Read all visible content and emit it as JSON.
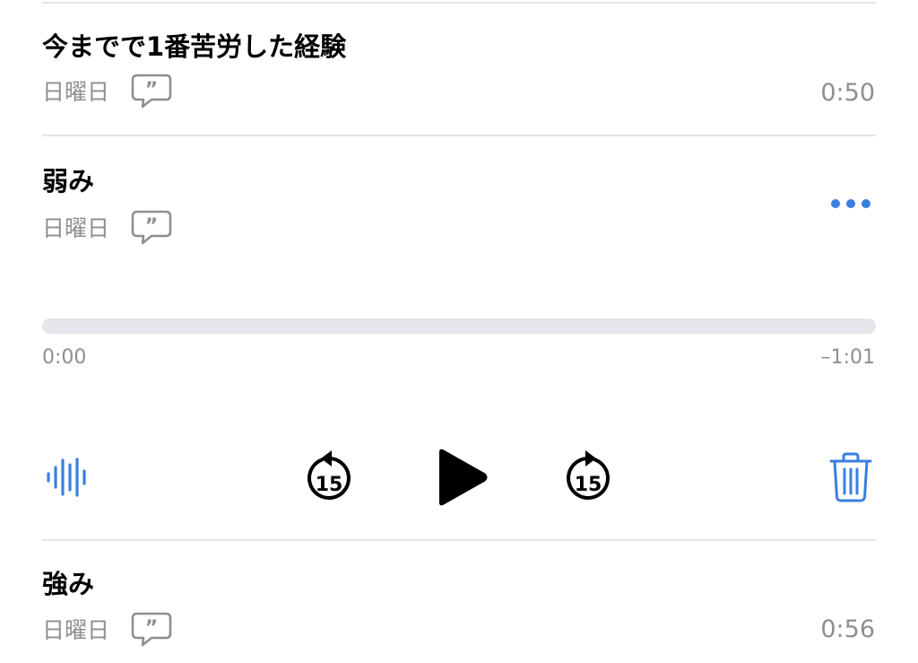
{
  "recordings": [
    {
      "title": "今までで1番苦労した経験",
      "date": "日曜日",
      "duration": "0:50"
    },
    {
      "title": "弱み",
      "date": "日曜日"
    },
    {
      "title": "強み",
      "date": "日曜日",
      "duration": "0:56"
    }
  ],
  "player": {
    "elapsed": "0:00",
    "remaining": "–1:01",
    "progress": 0,
    "skip_back_seconds": "15",
    "skip_forward_seconds": "15"
  },
  "icons": {
    "transcript": "quote-bubble-icon",
    "more": "ellipsis-icon",
    "waveform": "waveform-icon",
    "skip_back": "gobackward-15-icon",
    "play": "play-icon",
    "skip_forward": "goforward-15-icon",
    "delete": "trash-icon"
  },
  "colors": {
    "accent": "#3a7fe0",
    "secondary_text": "#8e8e93",
    "divider": "#e5e5ea",
    "primary_text": "#000000"
  }
}
